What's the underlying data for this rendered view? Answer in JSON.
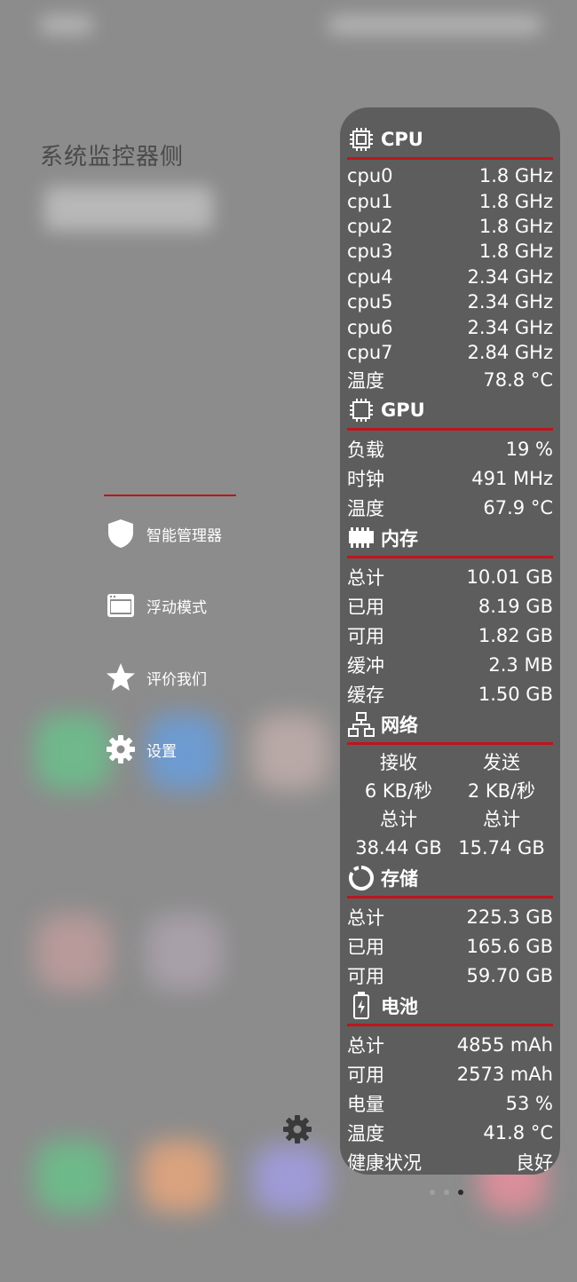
{
  "app": {
    "title": "系统监控器侧"
  },
  "drawer": {
    "items": [
      {
        "label": "智能管理器",
        "icon": "shield-icon"
      },
      {
        "label": "浮动模式",
        "icon": "window-icon"
      },
      {
        "label": "评价我们",
        "icon": "star-icon"
      },
      {
        "label": "设置",
        "icon": "gear-icon"
      }
    ]
  },
  "cpu": {
    "title": "CPU",
    "cores": [
      {
        "label": "cpu0",
        "value": "1.8 GHz"
      },
      {
        "label": "cpu1",
        "value": "1.8 GHz"
      },
      {
        "label": "cpu2",
        "value": "1.8 GHz"
      },
      {
        "label": "cpu3",
        "value": "1.8 GHz"
      },
      {
        "label": "cpu4",
        "value": "2.34 GHz"
      },
      {
        "label": "cpu5",
        "value": "2.34 GHz"
      },
      {
        "label": "cpu6",
        "value": "2.34 GHz"
      },
      {
        "label": "cpu7",
        "value": "2.84 GHz"
      }
    ],
    "temp_label": "温度",
    "temp_value": "78.8 °C"
  },
  "gpu": {
    "title": "GPU",
    "rows": [
      {
        "label": "负载",
        "value": "19 %"
      },
      {
        "label": "时钟",
        "value": "491 MHz"
      },
      {
        "label": "温度",
        "value": "67.9 °C"
      }
    ]
  },
  "memory": {
    "title": "内存",
    "rows": [
      {
        "label": "总计",
        "value": "10.01 GB"
      },
      {
        "label": "已用",
        "value": "8.19 GB"
      },
      {
        "label": "可用",
        "value": "1.82 GB"
      },
      {
        "label": "缓冲",
        "value": "2.3 MB"
      },
      {
        "label": "缓存",
        "value": "1.50 GB"
      }
    ]
  },
  "network": {
    "title": "网络",
    "receive_label": "接收",
    "send_label": "发送",
    "receive_rate": "6 KB/秒",
    "send_rate": "2 KB/秒",
    "total_label_rx": "总计",
    "total_label_tx": "总计",
    "receive_total": "38.44 GB",
    "send_total": "15.74 GB"
  },
  "storage": {
    "title": "存储",
    "rows": [
      {
        "label": "总计",
        "value": "225.3 GB"
      },
      {
        "label": "已用",
        "value": "165.6 GB"
      },
      {
        "label": "可用",
        "value": "59.70 GB"
      }
    ]
  },
  "battery": {
    "title": "电池",
    "rows": [
      {
        "label": "总计",
        "value": "4855 mAh"
      },
      {
        "label": "可用",
        "value": "2573 mAh"
      },
      {
        "label": "电量",
        "value": "53 %"
      },
      {
        "label": "温度",
        "value": "41.8 °C"
      },
      {
        "label": "健康状况",
        "value": "良好"
      }
    ]
  },
  "colors": {
    "accent": "#c0141c",
    "panel": "#5d5d5d",
    "background": "#8c8c8c"
  }
}
